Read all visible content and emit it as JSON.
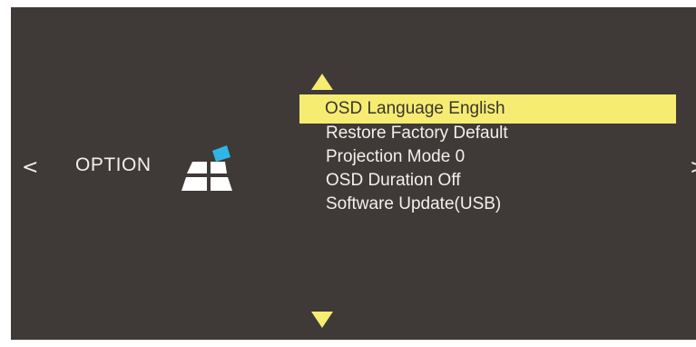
{
  "navigation": {
    "prev_label": "<",
    "next_label": ">"
  },
  "category": {
    "label": "OPTION",
    "icon": "option-tiles-icon"
  },
  "menu": {
    "scroll_up_icon": "triangle-up-icon",
    "scroll_down_icon": "triangle-down-icon",
    "items": [
      {
        "label": "OSD Language English",
        "selected": true
      },
      {
        "label": "Restore Factory Default",
        "selected": false
      },
      {
        "label": "Projection Mode 0",
        "selected": false
      },
      {
        "label": "OSD Duration Off",
        "selected": false
      },
      {
        "label": "Software Update(USB)",
        "selected": false
      }
    ]
  },
  "colors": {
    "background": "#3f3a37",
    "text": "#f2f0ec",
    "highlight": "#f6ec72",
    "arrow": "#f6ec72",
    "icon_tile": "#ffffff",
    "icon_accent": "#2fb6e6"
  }
}
